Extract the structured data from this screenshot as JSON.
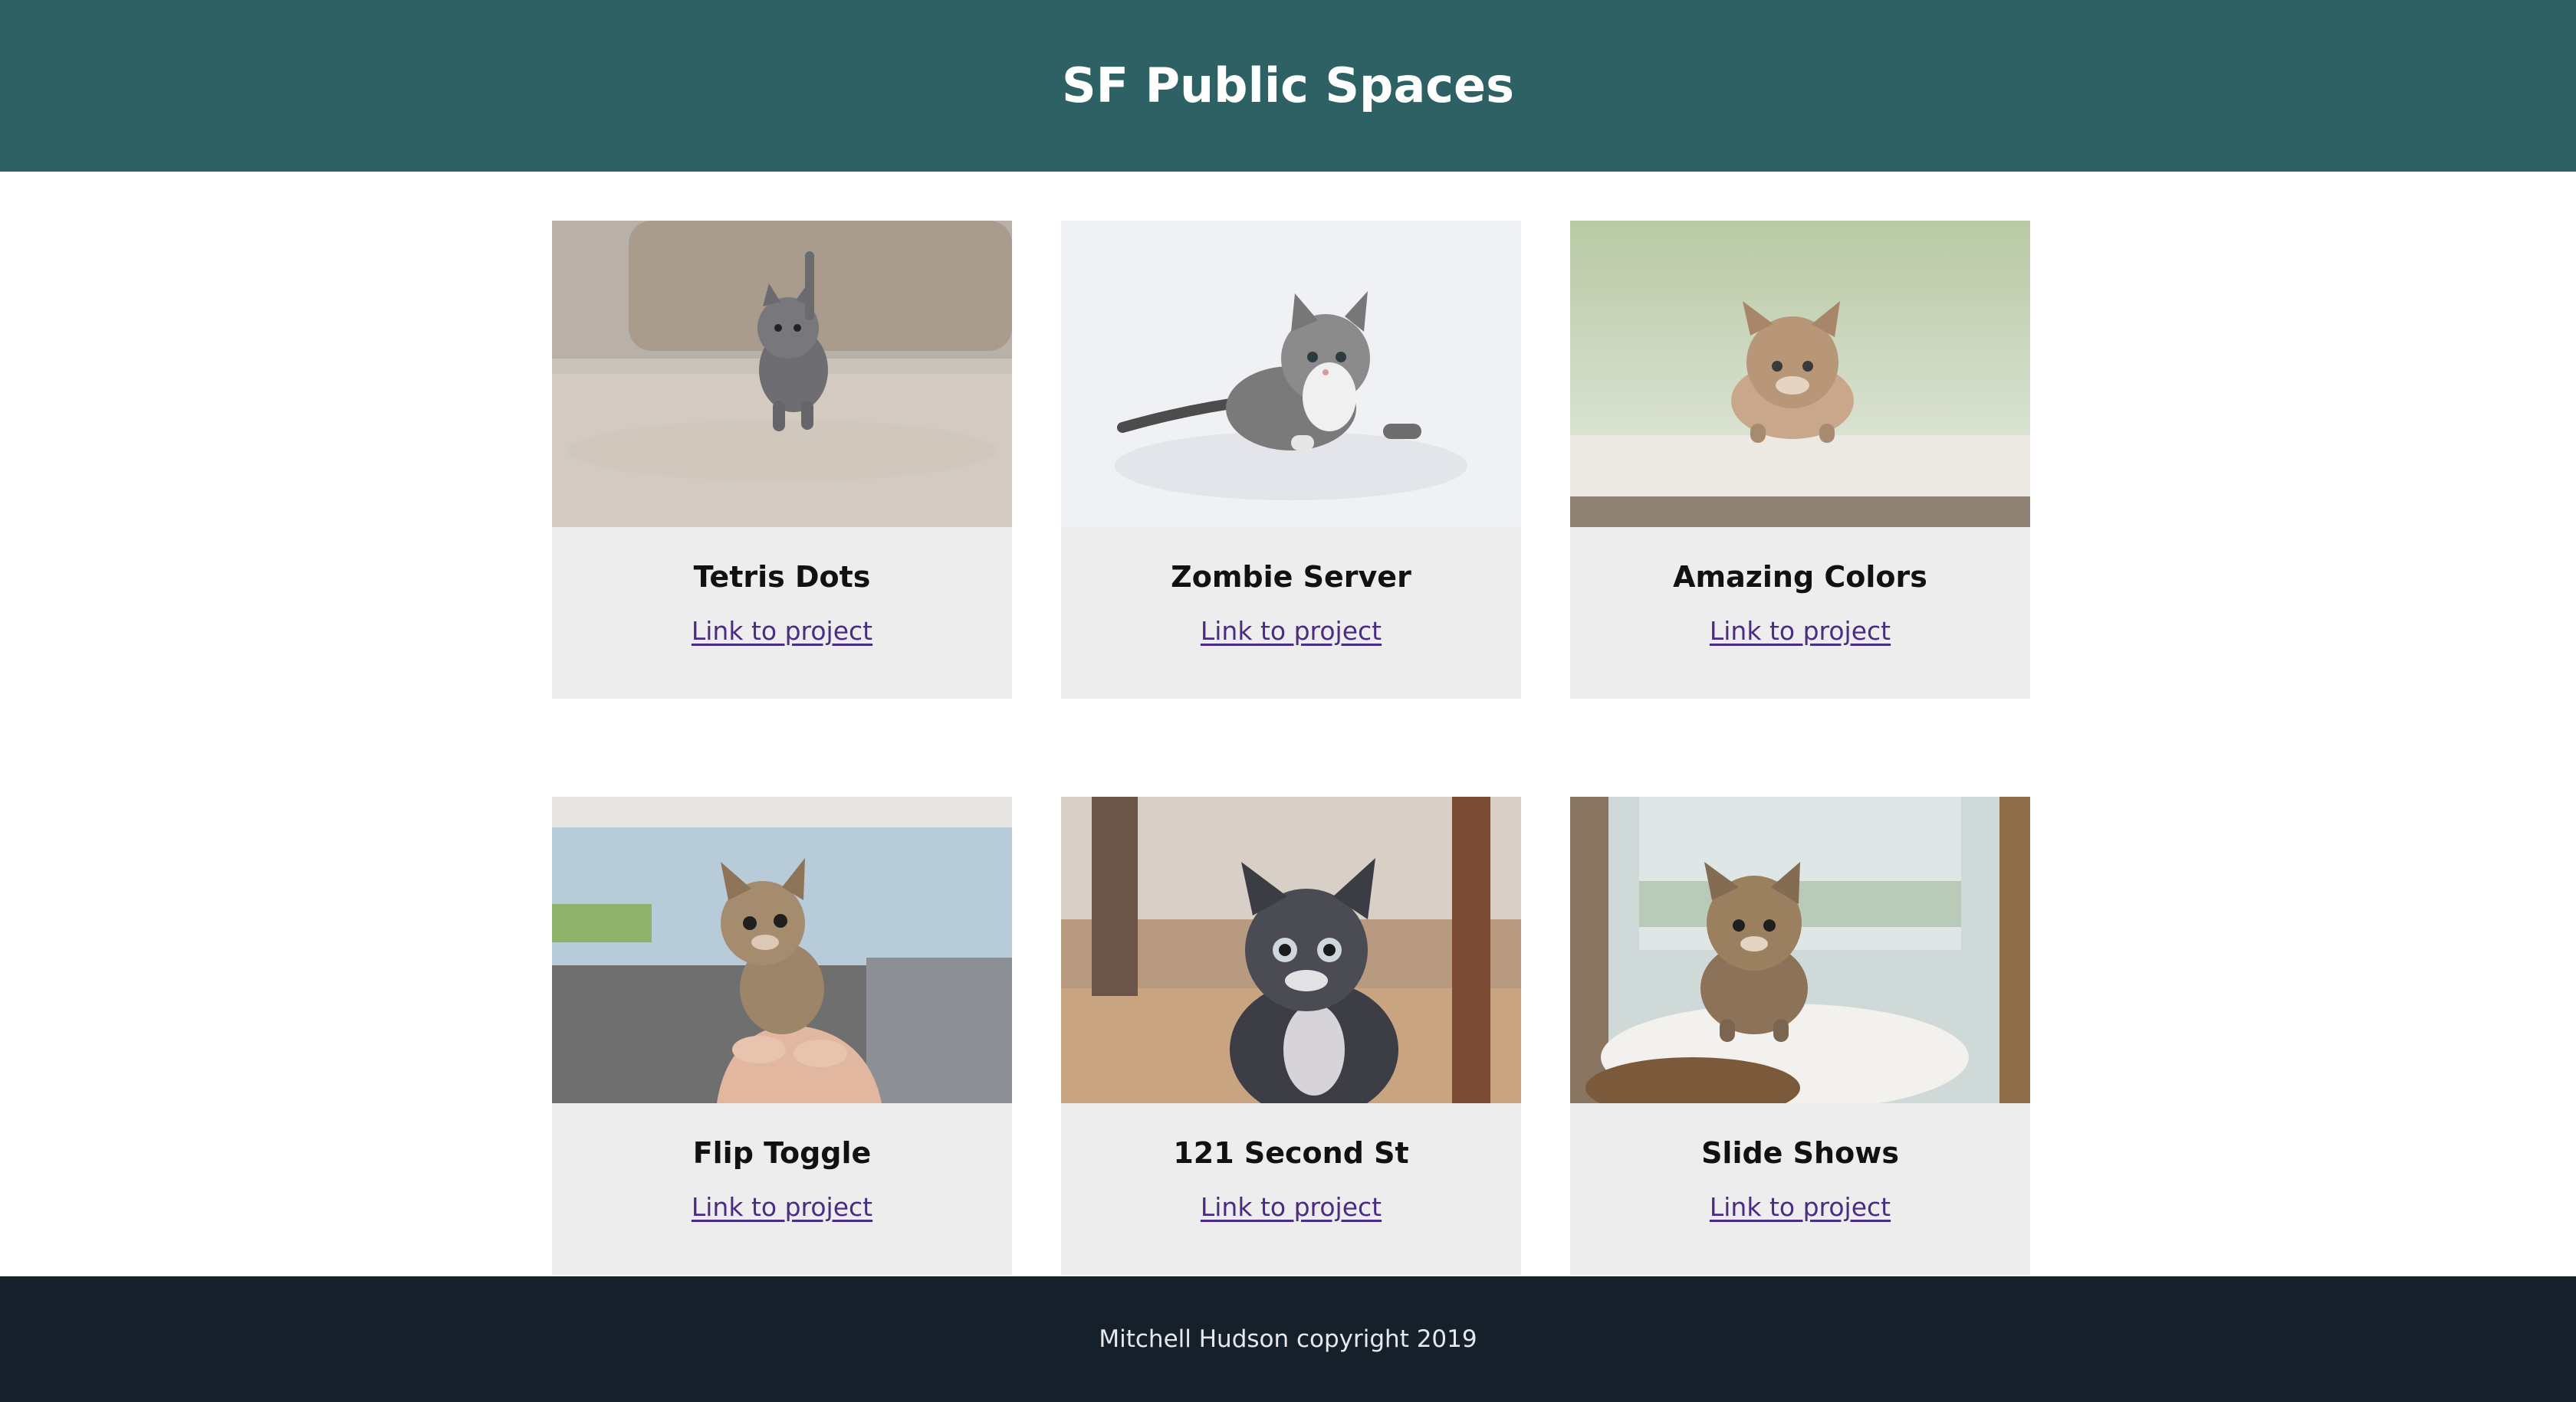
{
  "header": {
    "title": "SF Public Spaces"
  },
  "cards": [
    {
      "title": "Tetris Dots",
      "link_label": "Link to project",
      "image": "kitten-photo"
    },
    {
      "title": "Zombie Server",
      "link_label": "Link to project",
      "image": "kitten-photo"
    },
    {
      "title": "Amazing Colors",
      "link_label": "Link to project",
      "image": "kitten-photo"
    },
    {
      "title": "Flip Toggle",
      "link_label": "Link to project",
      "image": "kitten-photo"
    },
    {
      "title": "121 Second St",
      "link_label": "Link to project",
      "image": "kitten-photo"
    },
    {
      "title": "Slide Shows",
      "link_label": "Link to project",
      "image": "kitten-photo"
    }
  ],
  "footer": {
    "text": "Mitchell Hudson copyright 2019"
  },
  "colors": {
    "header_bg": "#2d6163",
    "footer_bg": "#16202b",
    "card_bg": "#ededed",
    "link": "#4a2b86"
  }
}
